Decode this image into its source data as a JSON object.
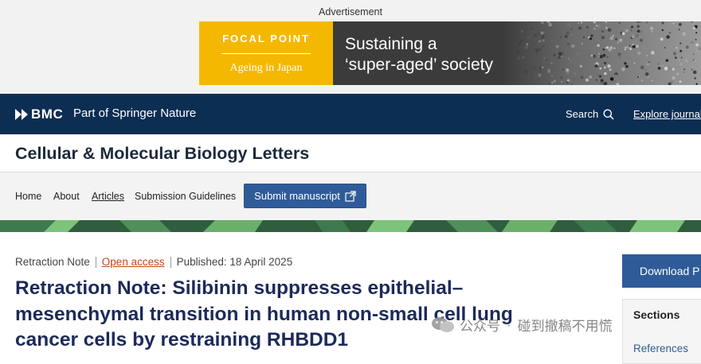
{
  "ad": {
    "label": "Advertisement",
    "focal": "FOCAL POINT",
    "subtitle": "Ageing in Japan",
    "headline_line1": "Sustaining a",
    "headline_line2": "‘super-aged’ society",
    "brand_color": "#f5b800"
  },
  "header": {
    "brand": "BMC",
    "part_of": "Part of Springer Nature",
    "search_label": "Search",
    "explore_label": "Explore journals",
    "bar_color": "#0d2e53"
  },
  "journal": {
    "title": "Cellular & Molecular Biology Letters"
  },
  "nav": {
    "home": "Home",
    "about": "About",
    "articles": "Articles",
    "submission_guidelines": "Submission Guidelines",
    "submit_manuscript": "Submit manuscript"
  },
  "article": {
    "type": "Retraction Note",
    "access": "Open access",
    "published": "Published: 18 April 2025",
    "title": "Retraction Note: Silibinin suppresses epithelial–mesenchymal transition in human non-small cell lung cancer cells by restraining RHBDD1"
  },
  "sidebar": {
    "download": "Download P",
    "sections_title": "Sections",
    "references": "References"
  },
  "watermark": {
    "account": "公众号",
    "name": "碰到撤稿不用慌"
  },
  "icons": {
    "search": "search-icon",
    "external": "external-link-icon",
    "wechat": "wechat-icon",
    "bmc": "bmc-logo-icon"
  }
}
